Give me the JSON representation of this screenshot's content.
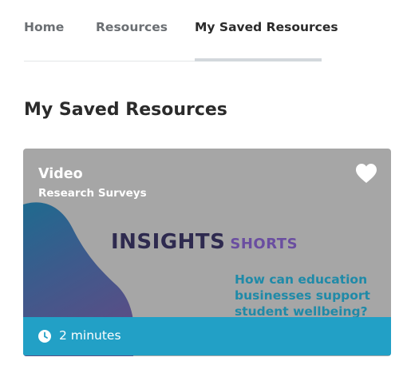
{
  "nav": {
    "tabs": [
      {
        "label": "Home"
      },
      {
        "label": "Resources"
      },
      {
        "label": "My Saved Resources",
        "active": true
      }
    ]
  },
  "page": {
    "title": "My Saved Resources"
  },
  "card": {
    "type": "Video",
    "category": "Research Surveys",
    "favorited": true,
    "thumbnail": {
      "brand_main": "INSIGHTS",
      "brand_sub": "SHORTS",
      "question": "How can education businesses support student wellbeing?"
    },
    "duration": "2 minutes",
    "icons": {
      "favorite": "heart-icon",
      "duration": "clock-icon"
    }
  },
  "colors": {
    "tab_underline": "#d3d8dc",
    "card_bg": "#a6a6a6",
    "duration_bar": "#22a0c6",
    "brand_main": "#2e2a4f",
    "brand_sub": "#6a4ea0",
    "question": "#1f8aa8"
  }
}
